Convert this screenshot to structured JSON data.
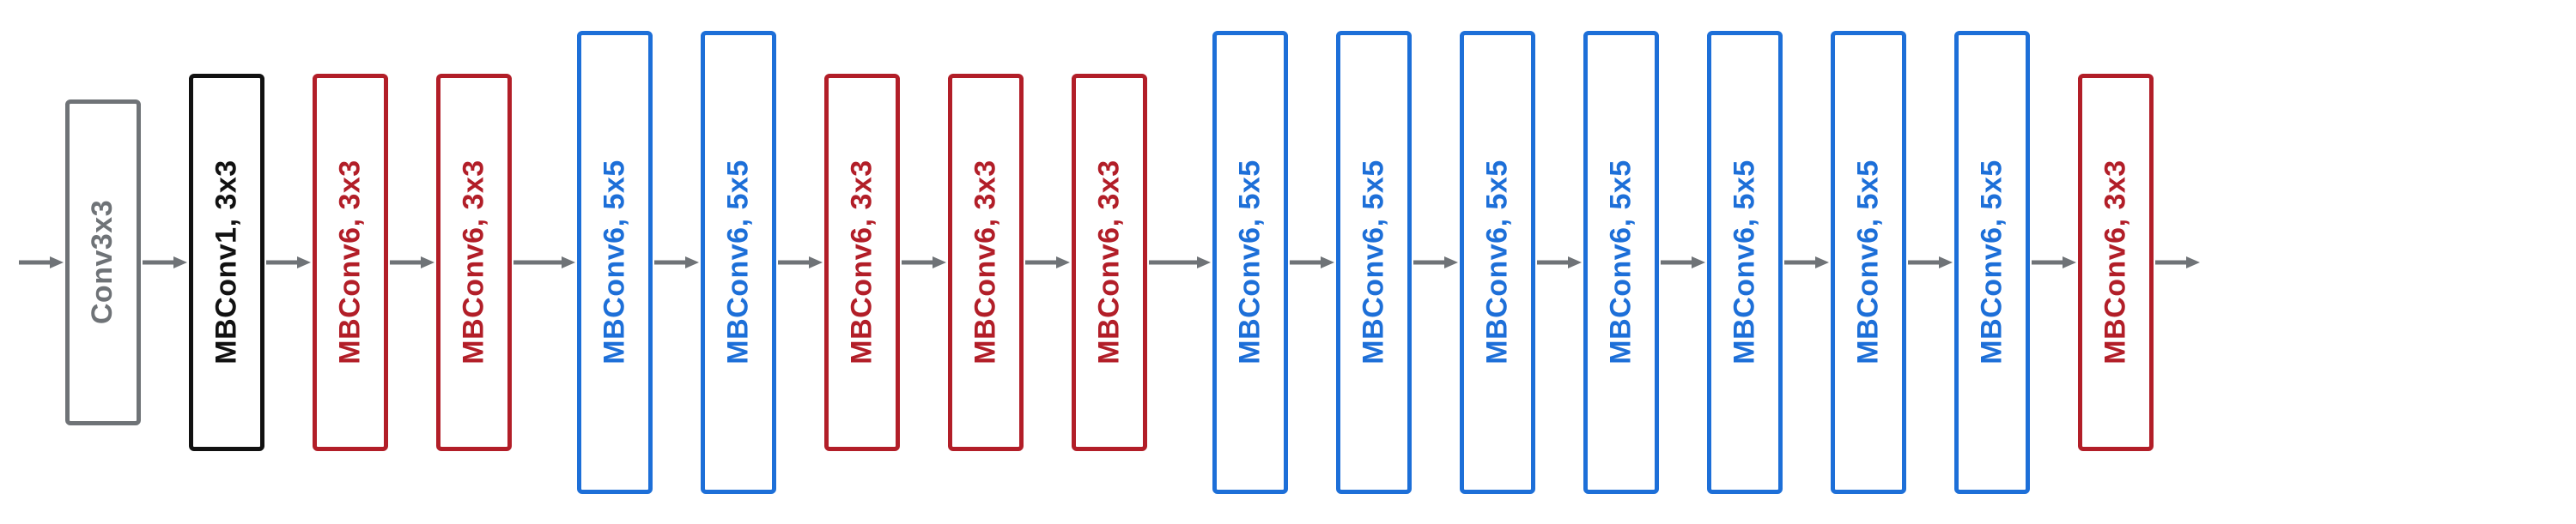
{
  "colors": {
    "gray": "#6f7377",
    "black": "#111111",
    "red": "#b21e28",
    "blue": "#1d6fd8",
    "arrow": "#6f7377"
  },
  "layers": [
    {
      "label": "Conv3x3",
      "color": "gray",
      "size": "h-short",
      "gapAfter": "narrow"
    },
    {
      "label": "MBConv1, 3x3",
      "color": "black",
      "size": "h-med",
      "gapAfter": "narrow"
    },
    {
      "label": "MBConv6, 3x3",
      "color": "red",
      "size": "h-med",
      "gapAfter": "narrow"
    },
    {
      "label": "MBConv6, 3x3",
      "color": "red",
      "size": "h-med",
      "gapAfter": "wide"
    },
    {
      "label": "MBConv6, 5x5",
      "color": "blue",
      "size": "h-tall",
      "gapAfter": "narrow"
    },
    {
      "label": "MBConv6, 5x5",
      "color": "blue",
      "size": "h-tall",
      "gapAfter": "narrow"
    },
    {
      "label": "MBConv6, 3x3",
      "color": "red",
      "size": "h-med",
      "gapAfter": "narrow"
    },
    {
      "label": "MBConv6, 3x3",
      "color": "red",
      "size": "h-med",
      "gapAfter": "narrow"
    },
    {
      "label": "MBConv6, 3x3",
      "color": "red",
      "size": "h-med",
      "gapAfter": "wide"
    },
    {
      "label": "MBConv6, 5x5",
      "color": "blue",
      "size": "h-tall",
      "gapAfter": "narrow"
    },
    {
      "label": "MBConv6, 5x5",
      "color": "blue",
      "size": "h-tall",
      "gapAfter": "narrow"
    },
    {
      "label": "MBConv6, 5x5",
      "color": "blue",
      "size": "h-tall",
      "gapAfter": "narrow"
    },
    {
      "label": "MBConv6, 5x5",
      "color": "blue",
      "size": "h-tall",
      "gapAfter": "narrow"
    },
    {
      "label": "MBConv6, 5x5",
      "color": "blue",
      "size": "h-tall",
      "gapAfter": "narrow"
    },
    {
      "label": "MBConv6, 5x5",
      "color": "blue",
      "size": "h-tall",
      "gapAfter": "narrow"
    },
    {
      "label": "MBConv6, 5x5",
      "color": "blue",
      "size": "h-tall",
      "gapAfter": "narrow"
    },
    {
      "label": "MBConv6, 3x3",
      "color": "red",
      "size": "h-med",
      "gapAfter": "narrow"
    }
  ]
}
